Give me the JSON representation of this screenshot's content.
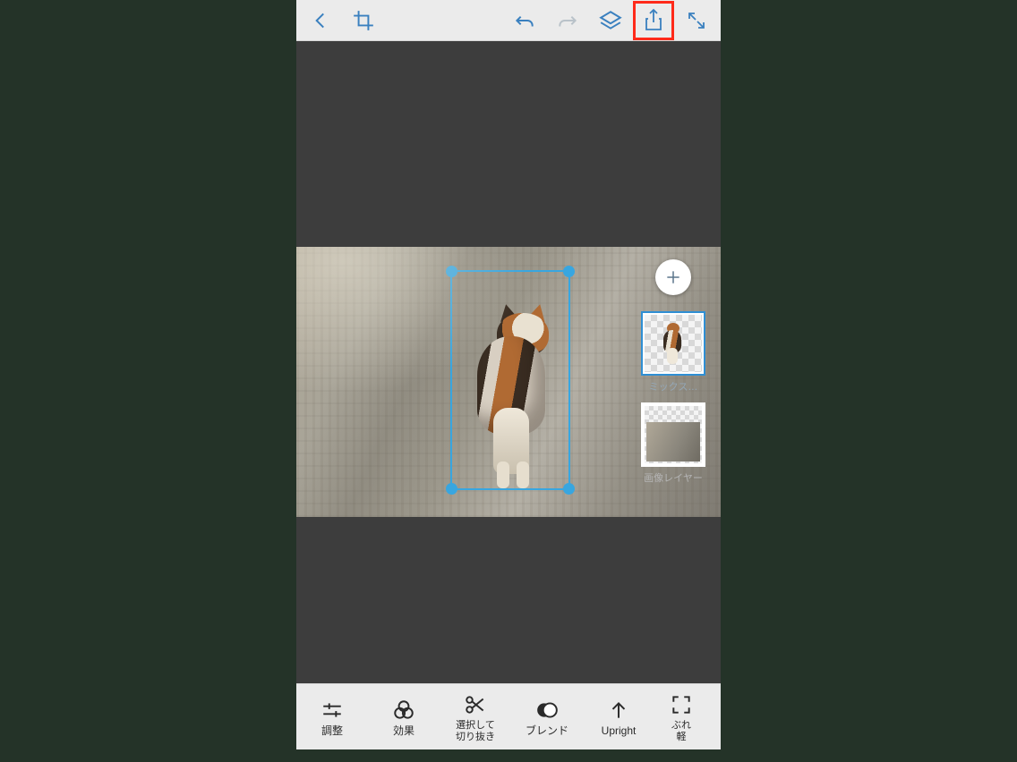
{
  "toolbar": {
    "icons": {
      "back": "back-icon",
      "crop": "crop-icon",
      "undo": "undo-icon",
      "redo": "redo-icon",
      "layers": "layers-icon",
      "share": "share-icon",
      "expand": "expand-icon"
    },
    "highlighted": "share"
  },
  "layers": {
    "add_icon": "plus-icon",
    "items": [
      {
        "label": "ミックス…",
        "selected": true
      },
      {
        "label": "画像レイヤー",
        "selected": false
      }
    ]
  },
  "tools": [
    {
      "id": "adjust",
      "label": "調整",
      "icon": "sliders-icon"
    },
    {
      "id": "effects",
      "label": "効果",
      "icon": "overlap-circles-icon"
    },
    {
      "id": "cutout",
      "label": "選択して\n切り抜き",
      "icon": "scissors-icon"
    },
    {
      "id": "blend",
      "label": "ブレンド",
      "icon": "blend-icon"
    },
    {
      "id": "upright",
      "label": "Upright",
      "icon": "arrow-up-icon"
    },
    {
      "id": "blur",
      "label": "ぶれ\n軽",
      "icon": "focus-corners-icon"
    }
  ]
}
